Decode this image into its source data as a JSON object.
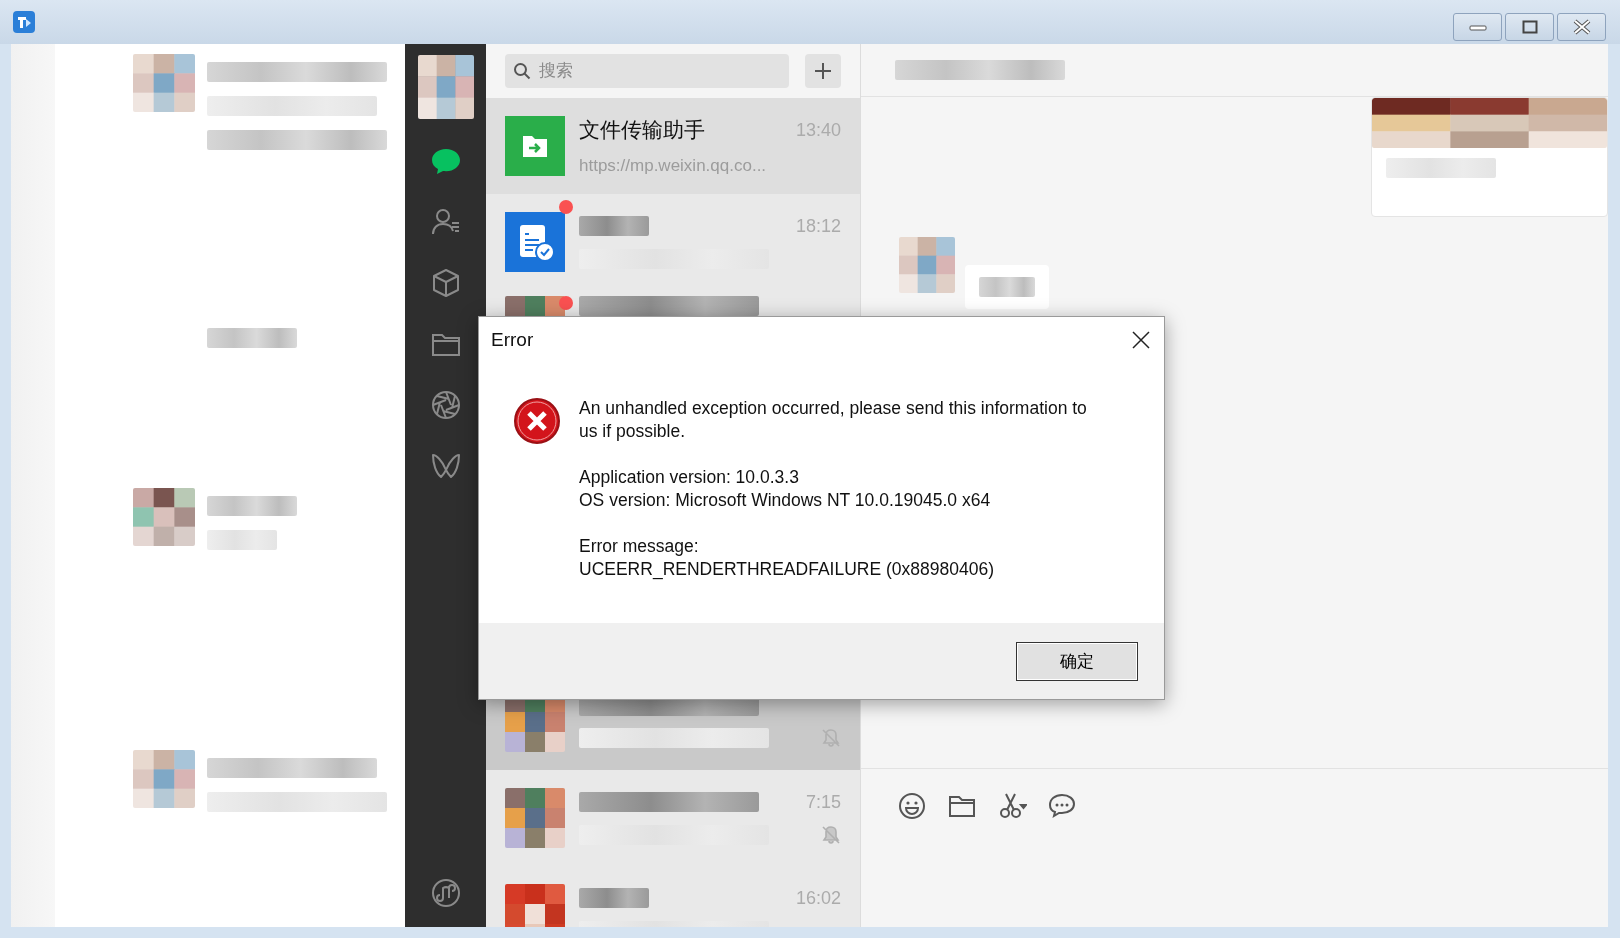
{
  "sidebar": {
    "top_items": [
      {
        "kind": "chat",
        "selected": true
      },
      {
        "kind": "contacts",
        "selected": false
      },
      {
        "kind": "box",
        "selected": false
      },
      {
        "kind": "folder",
        "selected": false
      },
      {
        "kind": "aperture",
        "selected": false
      },
      {
        "kind": "butterfly",
        "selected": false
      }
    ],
    "bottom_items": [
      {
        "kind": "miniprogram",
        "selected": false
      }
    ]
  },
  "search": {
    "placeholder": "搜索"
  },
  "chats_top": [
    {
      "kind": "file",
      "name": "文件传输助手",
      "time": "13:40",
      "preview": "https://mp.weixin.qq.co...",
      "selected": false,
      "unread": false,
      "muted": false
    },
    {
      "kind": "doc",
      "time": "18:12",
      "selected": false,
      "unread": true,
      "muted": false
    },
    {
      "kind": "group",
      "selected": false,
      "unread": true,
      "muted": false
    }
  ],
  "chats_bottom": [
    {
      "kind": "group",
      "selected": true,
      "unread": false,
      "muted": true
    },
    {
      "kind": "group",
      "time": "7:15",
      "selected": false,
      "unread": false,
      "muted": true
    },
    {
      "kind": "red",
      "time": "16:02",
      "selected": false,
      "unread": false,
      "muted": false
    }
  ],
  "dialog": {
    "title": "Error",
    "paragraphs": [
      [
        "An unhandled exception occurred, please send this information to us if possible."
      ],
      [
        "Application version: 10.0.3.3",
        "OS version: Microsoft Windows NT 10.0.19045.0 x64"
      ],
      [
        "Error message:",
        "UCEERR_RENDERTHREADFAILURE (0x88980406)"
      ]
    ],
    "button": "确定"
  }
}
